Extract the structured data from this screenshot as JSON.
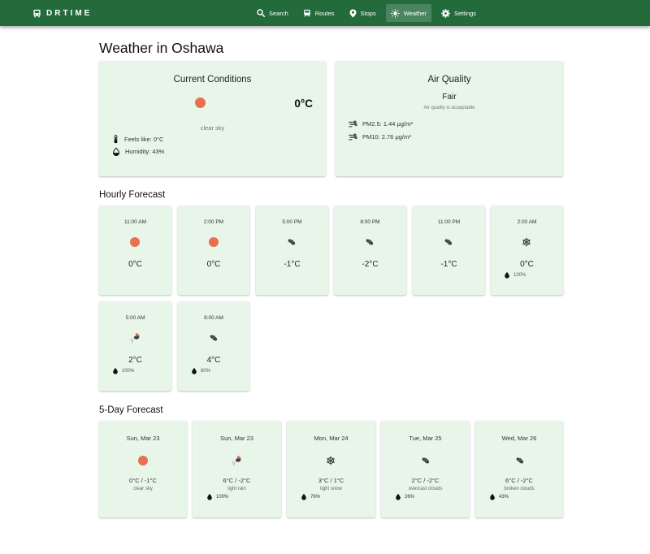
{
  "app": {
    "brand": "DRTIME"
  },
  "nav": {
    "items": [
      {
        "label": "Search",
        "icon": "search-icon"
      },
      {
        "label": "Routes",
        "icon": "bus-icon"
      },
      {
        "label": "Stops",
        "icon": "location-pin-icon"
      },
      {
        "label": "Weather",
        "icon": "sun-icon",
        "active": true
      },
      {
        "label": "Settings",
        "icon": "gear-icon"
      }
    ]
  },
  "page": {
    "title": "Weather in Oshawa"
  },
  "current": {
    "title": "Current Conditions",
    "temp": "0°C",
    "description": "clear sky",
    "feels_like": "Feels like: 0°C",
    "humidity": "Humidity: 43%",
    "icon": "clear-sky-icon"
  },
  "air_quality": {
    "title": "Air Quality",
    "level": "Fair",
    "message": "Air quality is acceptable",
    "pm25": "PM2.5: 1.44 μg/m³",
    "pm10": "PM10: 2.76 μg/m³"
  },
  "hourly": {
    "title": "Hourly Forecast",
    "items": [
      {
        "time": "11:00 AM",
        "temp": "0°C",
        "icon": "clear-sky-icon",
        "precip": ""
      },
      {
        "time": "2:00 PM",
        "temp": "0°C",
        "icon": "clear-sky-icon",
        "precip": ""
      },
      {
        "time": "5:00 PM",
        "temp": "-1°C",
        "icon": "cloud-icon",
        "precip": ""
      },
      {
        "time": "8:00 PM",
        "temp": "-2°C",
        "icon": "cloud-icon",
        "precip": ""
      },
      {
        "time": "11:00 PM",
        "temp": "-1°C",
        "icon": "cloud-icon",
        "precip": ""
      },
      {
        "time": "2:00 AM",
        "temp": "0°C",
        "icon": "snowflake-icon",
        "precip": "100%"
      },
      {
        "time": "5:00 AM",
        "temp": "2°C",
        "icon": "rain-icon",
        "precip": "100%"
      },
      {
        "time": "8:00 AM",
        "temp": "4°C",
        "icon": "cloud-icon",
        "precip": "80%"
      }
    ]
  },
  "daily": {
    "title": "5-Day Forecast",
    "items": [
      {
        "date": "Sun, Mar 23",
        "temp": "0°C / -1°C",
        "desc": "clear sky",
        "icon": "clear-sky-icon",
        "precip": ""
      },
      {
        "date": "Sun, Mar 23",
        "temp": "6°C / -2°C",
        "desc": "light rain",
        "icon": "rain-icon",
        "precip": "100%"
      },
      {
        "date": "Mon, Mar 24",
        "temp": "3°C / 1°C",
        "desc": "light snow",
        "icon": "snowflake-icon",
        "precip": "76%"
      },
      {
        "date": "Tue, Mar 25",
        "temp": "2°C / -2°C",
        "desc": "overcast clouds",
        "icon": "cloud-icon",
        "precip": "26%"
      },
      {
        "date": "Wed, Mar 26",
        "temp": "6°C / -2°C",
        "desc": "broken clouds",
        "icon": "cloud-icon",
        "precip": "43%"
      }
    ]
  },
  "colors": {
    "header": "#246b3c",
    "card": "#e8f5e9",
    "sun": "#e8704f"
  }
}
